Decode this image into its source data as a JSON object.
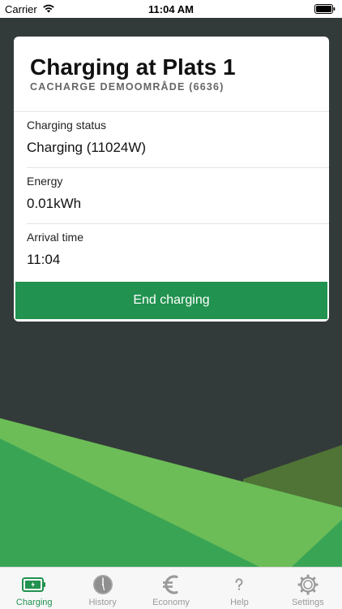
{
  "status_bar": {
    "carrier": "Carrier",
    "time": "11:04 AM"
  },
  "card": {
    "title": "Charging at Plats 1",
    "subtitle": "CACHARGE DEMOOMRÅDE (6636)",
    "fields": [
      {
        "label": "Charging status",
        "value": "Charging (11024W)"
      },
      {
        "label": "Energy",
        "value": "0.01kWh"
      },
      {
        "label": "Arrival time",
        "value": "11:04"
      }
    ],
    "end_button_label": "End charging"
  },
  "tab_bar": {
    "tabs": [
      {
        "label": "Charging",
        "icon": "battery-charging-icon",
        "active": true
      },
      {
        "label": "History",
        "icon": "clock-icon",
        "active": false
      },
      {
        "label": "Economy",
        "icon": "euro-icon",
        "active": false
      },
      {
        "label": "Help",
        "icon": "question-icon",
        "active": false
      },
      {
        "label": "Settings",
        "icon": "gear-icon",
        "active": false
      }
    ]
  },
  "colors": {
    "accent": "#21924f",
    "background": "#333a3a",
    "light_green": "#6cbd57",
    "mid_green": "#3aa455",
    "olive_green": "#4f7436",
    "inactive": "#9a9a9a"
  }
}
